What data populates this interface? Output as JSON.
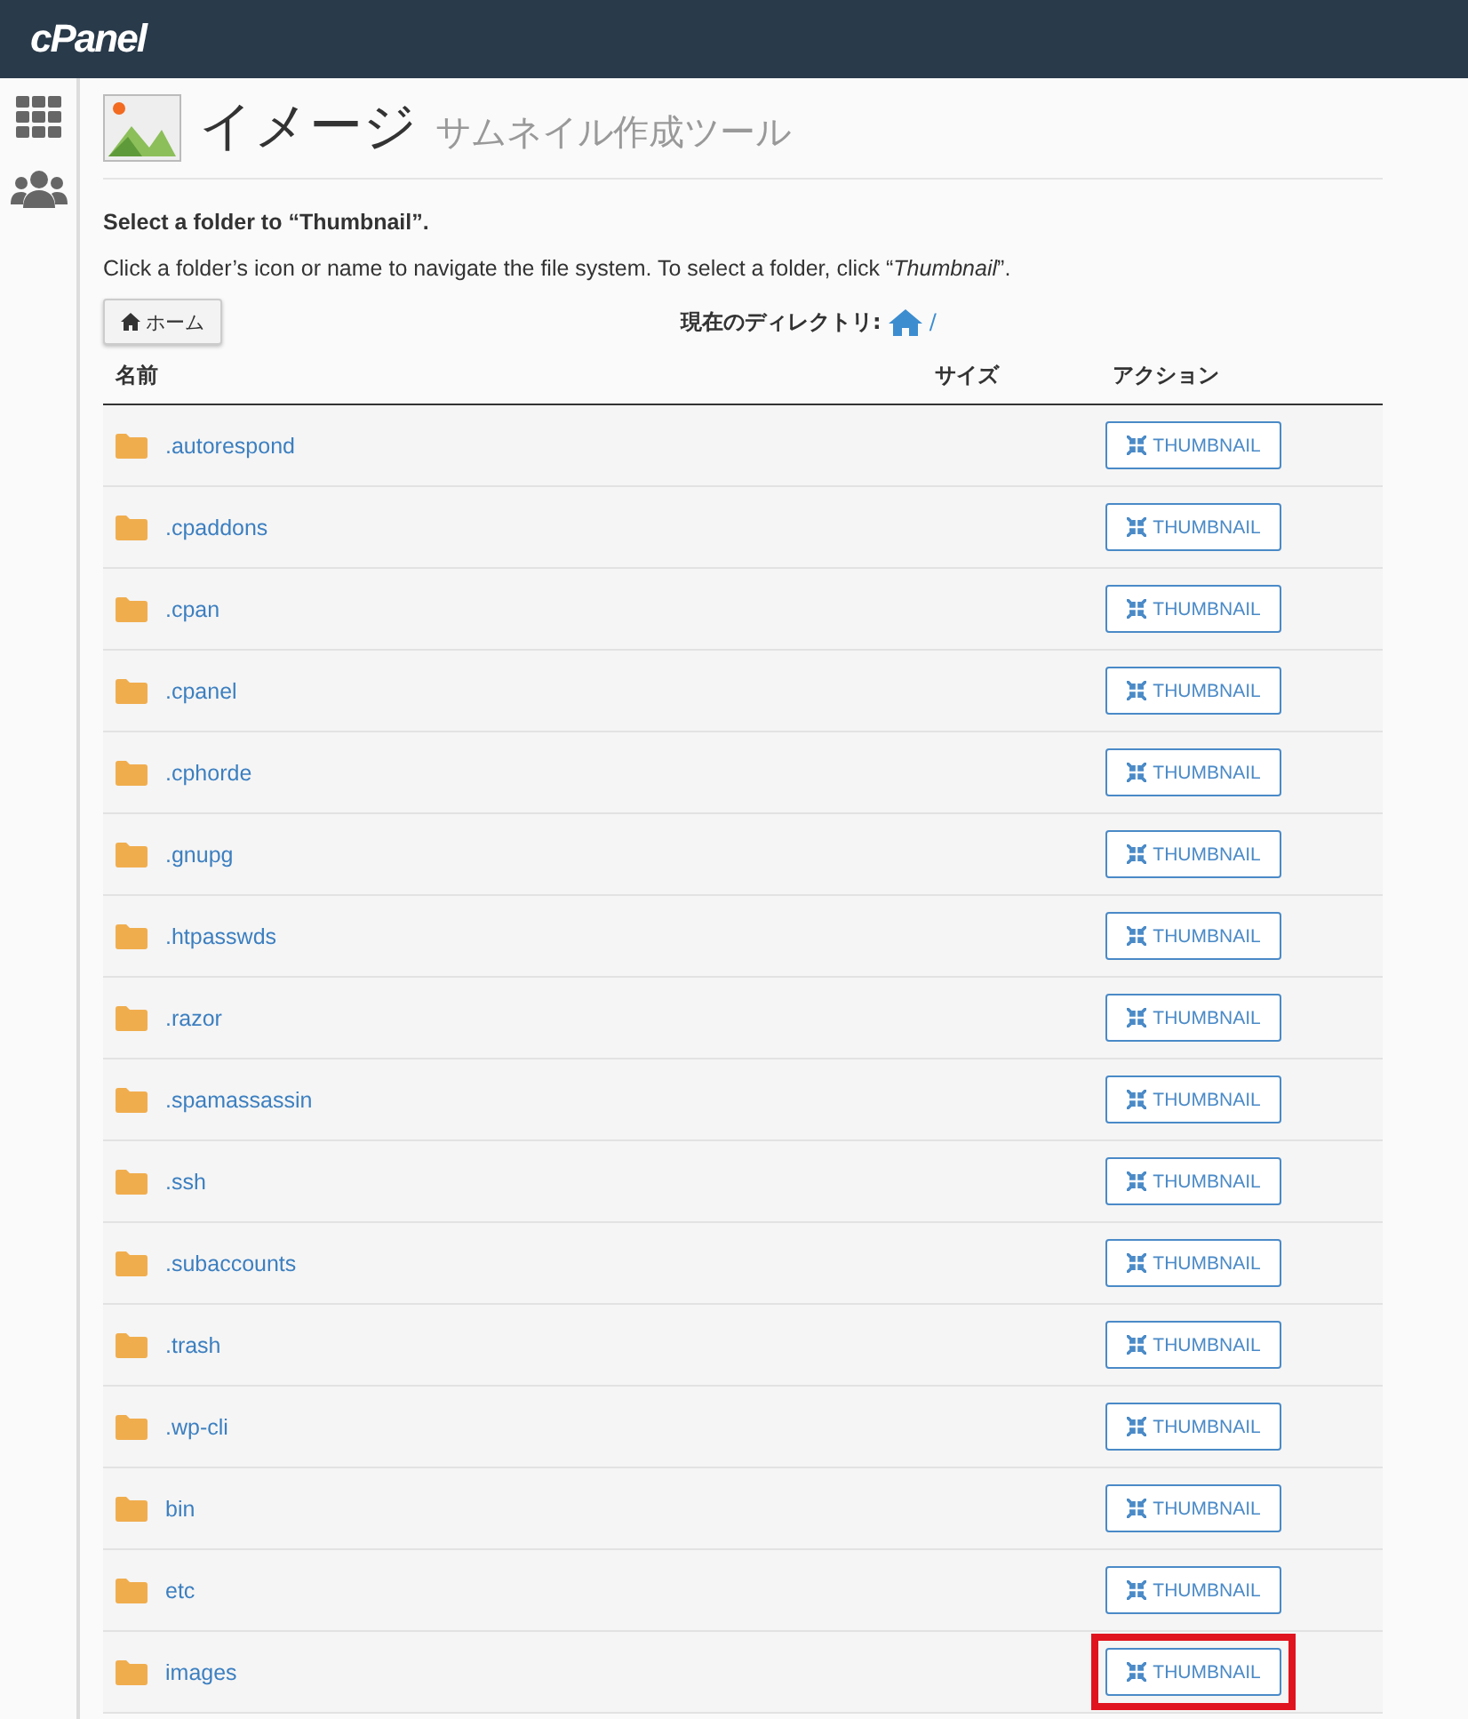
{
  "brand": "cPanel",
  "page": {
    "title": "イメージ",
    "subtitle": "サムネイル作成ツール"
  },
  "heading": "Select a folder to “Thumbnail”.",
  "instructions": "Click a folder’s icon or name to navigate the file system. To select a folder, click “*Thumbnail*”.",
  "home_button": "ホーム",
  "current_directory": {
    "label": "現在のディレクトリ:",
    "path": "/"
  },
  "table": {
    "columns": [
      "名前",
      "サイズ",
      "アクション"
    ],
    "rows": [
      {
        "name": ".autorespond",
        "action": "THUMBNAIL",
        "highlighted": false
      },
      {
        "name": ".cpaddons",
        "action": "THUMBNAIL",
        "highlighted": false
      },
      {
        "name": ".cpan",
        "action": "THUMBNAIL",
        "highlighted": false
      },
      {
        "name": ".cpanel",
        "action": "THUMBNAIL",
        "highlighted": false
      },
      {
        "name": ".cphorde",
        "action": "THUMBNAIL",
        "highlighted": false
      },
      {
        "name": ".gnupg",
        "action": "THUMBNAIL",
        "highlighted": false
      },
      {
        "name": ".htpasswds",
        "action": "THUMBNAIL",
        "highlighted": false
      },
      {
        "name": ".razor",
        "action": "THUMBNAIL",
        "highlighted": false
      },
      {
        "name": ".spamassassin",
        "action": "THUMBNAIL",
        "highlighted": false
      },
      {
        "name": ".ssh",
        "action": "THUMBNAIL",
        "highlighted": false
      },
      {
        "name": ".subaccounts",
        "action": "THUMBNAIL",
        "highlighted": false
      },
      {
        "name": ".trash",
        "action": "THUMBNAIL",
        "highlighted": false
      },
      {
        "name": ".wp-cli",
        "action": "THUMBNAIL",
        "highlighted": false
      },
      {
        "name": "bin",
        "action": "THUMBNAIL",
        "highlighted": false
      },
      {
        "name": "etc",
        "action": "THUMBNAIL",
        "highlighted": false
      },
      {
        "name": "images",
        "action": "THUMBNAIL",
        "highlighted": true
      }
    ]
  }
}
